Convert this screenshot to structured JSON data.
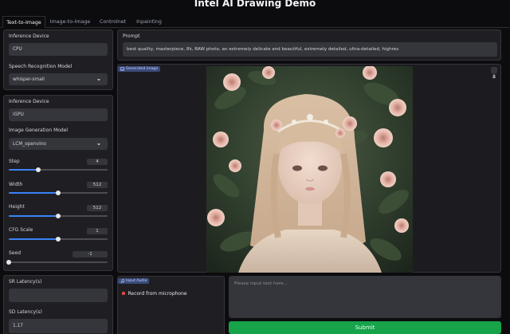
{
  "app": {
    "title": "Intel AI Drawing Demo"
  },
  "tabs": [
    {
      "label": "Text-to-Image",
      "active": true
    },
    {
      "label": "Image-to-Image",
      "active": false
    },
    {
      "label": "Controlnet",
      "active": false
    },
    {
      "label": "Inpainting",
      "active": false
    }
  ],
  "speech_panel": {
    "device_label": "Inference Device",
    "device_value": "CPU",
    "model_label": "Speech Recognition Model",
    "model_value": "whisper-small"
  },
  "image_panel": {
    "device_label": "Inference Device",
    "device_value": "iGPU",
    "model_label": "Image Generation Model",
    "model_value": "LCM_openvino",
    "sliders": [
      {
        "label": "Step",
        "value": "4",
        "fraction": 0.3
      },
      {
        "label": "Width",
        "value": "512",
        "fraction": 0.5
      },
      {
        "label": "Height",
        "value": "512",
        "fraction": 0.5
      },
      {
        "label": "CFG Scale",
        "value": "1",
        "fraction": 0.5
      },
      {
        "label": "Seed",
        "value": "-1",
        "fraction": 0.0
      }
    ]
  },
  "latency_panel": {
    "sr_label": "SR Latency(s)",
    "sr_value": "",
    "sd_label": "SD Latency(s)",
    "sd_value": "1.17"
  },
  "prompt": {
    "label": "Prompt",
    "value": "best quality, masterpiece, 8k, RAW photo, an extremely delicate and beautiful, extremely detailed, ultra-detailed, highres"
  },
  "generated": {
    "badge": "Generated image",
    "badge_icon": "image-icon",
    "download_icon": "download-icon"
  },
  "audio": {
    "badge": "Input Audio",
    "badge_icon": "music-icon",
    "record_label": "Record from microphone"
  },
  "text_input": {
    "placeholder": "Please input text here..."
  },
  "submit_label": "Submit",
  "colors": {
    "submit": "#16a34a",
    "slider": "#3b82f6",
    "record_dot": "#ef4444"
  }
}
